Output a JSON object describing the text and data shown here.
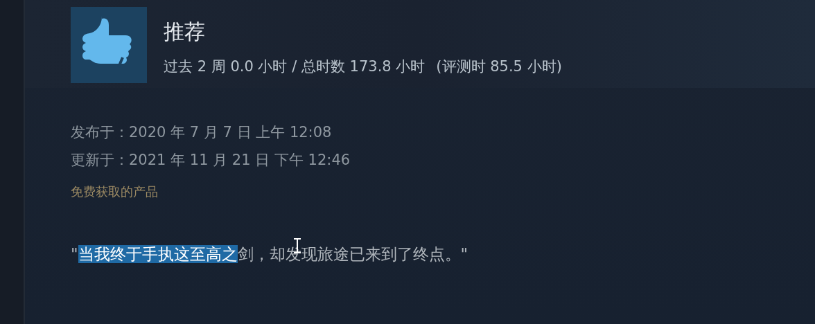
{
  "review": {
    "verdict": "推荐",
    "hours": "过去 2 周 0.0 小时 / 总时数 173.8 小时",
    "hours_at_review": "(评测时 85.5 小时)",
    "posted": "发布于：2020 年 7 月 7 日 上午 12:08",
    "updated": "更新于：2021 年 11 月 21 日 下午 12:46",
    "received_free": "免费获取的产品",
    "text_segments": [
      {
        "text": "\"",
        "selected": false
      },
      {
        "text": "当我终于手执这至高之",
        "selected": true
      },
      {
        "text": "剑，却发现旅途已来到了终点。\"",
        "selected": false
      }
    ]
  }
}
